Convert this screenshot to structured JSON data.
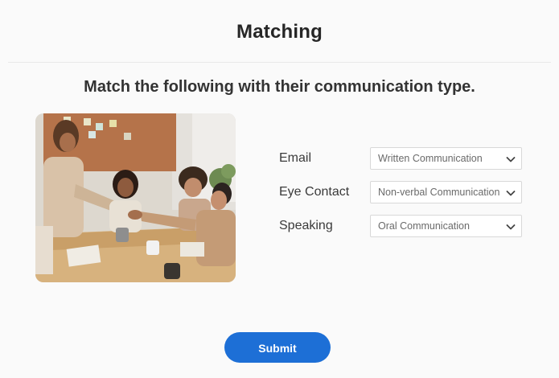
{
  "header": {
    "title": "Matching"
  },
  "question": {
    "instruction": "Match the following with their communication type."
  },
  "image": {
    "description_icon": "office-meeting-photo"
  },
  "matches": [
    {
      "label": "Email",
      "selected": "Written Communication"
    },
    {
      "label": "Eye Contact",
      "selected": "Non-verbal Communication"
    },
    {
      "label": "Speaking",
      "selected": "Oral Communication"
    }
  ],
  "actions": {
    "submit_label": "Submit"
  },
  "colors": {
    "accent": "#1d6fd6",
    "background": "#fafafa",
    "select_border": "#d8d8d8"
  }
}
